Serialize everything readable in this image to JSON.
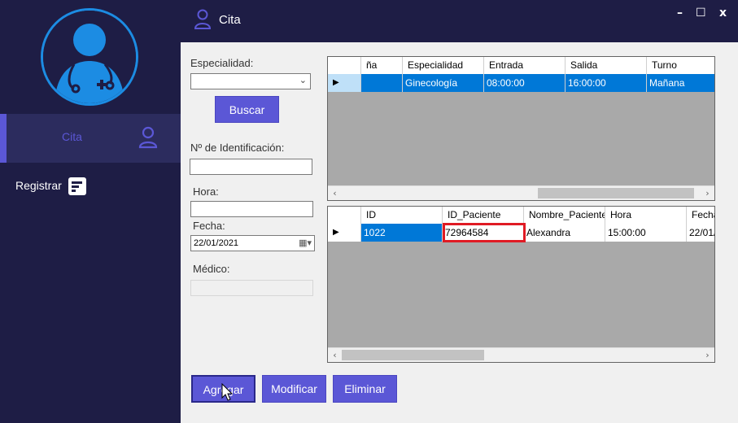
{
  "window": {
    "title": "Cita",
    "controls": [
      "–",
      "☐",
      "x"
    ]
  },
  "sidebar": {
    "avatar_icon": "doctor-icon",
    "items": [
      {
        "label": "Cita",
        "icon": "user-icon",
        "active": true
      },
      {
        "label": "Registrar",
        "icon": "form-icon",
        "active": false
      }
    ]
  },
  "form": {
    "especialidad_label": "Especialidad:",
    "especialidad_value": "",
    "buscar_label": "Buscar",
    "identificacion_label": "Nº de Identificación:",
    "identificacion_value": "",
    "hora_label": "Hora:",
    "hora_value": "",
    "fecha_label": "Fecha:",
    "fecha_value": "22/01/2021",
    "medico_label": "Médico:",
    "medico_value": ""
  },
  "grid_schedule": {
    "columns": [
      "ña",
      "Especialidad",
      "Entrada",
      "Salida",
      "Turno"
    ],
    "rows": [
      [
        "",
        "Ginecología",
        "08:00:00",
        "16:00:00",
        "Mañana"
      ]
    ]
  },
  "grid_citas": {
    "columns": [
      "ID",
      "ID_Paciente",
      "Nombre_Paciente",
      "Hora",
      "Fecha"
    ],
    "rows": [
      [
        "1022",
        "72964584",
        "Alexandra",
        "15:00:00",
        "22/01/"
      ]
    ]
  },
  "actions": {
    "agregar": "Agregar",
    "modificar": "Modificar",
    "eliminar": "Eliminar"
  },
  "colors": {
    "sidebar": "#1e1d45",
    "accent": "#5b57d6",
    "selection": "#0078d7",
    "highlight": "#e01b24"
  }
}
